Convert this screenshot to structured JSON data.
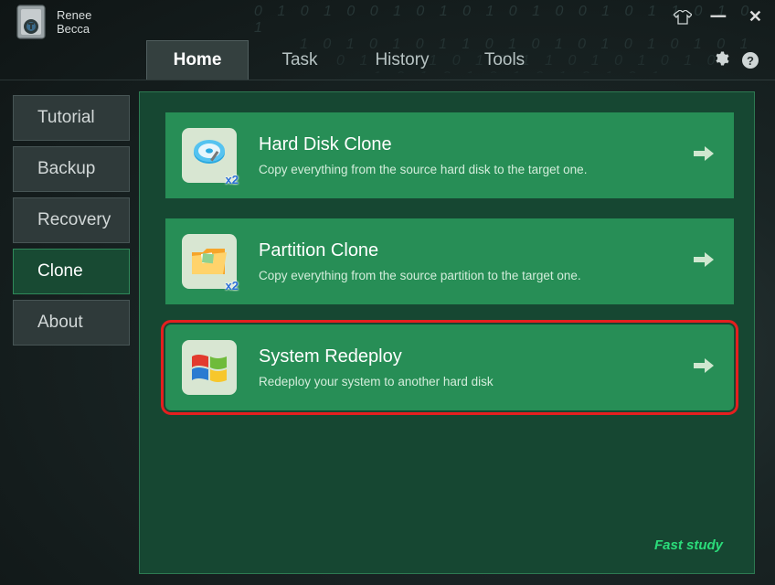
{
  "app": {
    "title_line1": "Renee",
    "title_line2": "Becca"
  },
  "top_tabs": [
    {
      "label": "Home",
      "active": true
    },
    {
      "label": "Task",
      "active": false
    },
    {
      "label": "History",
      "active": false
    },
    {
      "label": "Tools",
      "active": false
    }
  ],
  "sidebar": {
    "items": [
      {
        "label": "Tutorial",
        "active": false
      },
      {
        "label": "Backup",
        "active": false
      },
      {
        "label": "Recovery",
        "active": false
      },
      {
        "label": "Clone",
        "active": true
      },
      {
        "label": "About",
        "active": false
      }
    ]
  },
  "cards": [
    {
      "title": "Hard Disk Clone",
      "desc": "Copy everything from the source hard disk to the target one.",
      "badge": "x2",
      "icon": "hard-disk-icon",
      "highlight": false
    },
    {
      "title": "Partition Clone",
      "desc": "Copy everything from the source partition to the target one.",
      "badge": "x2",
      "icon": "folder-icon",
      "highlight": false
    },
    {
      "title": "System Redeploy",
      "desc": "Redeploy your system to another hard disk",
      "badge": "",
      "icon": "windows-flag-icon",
      "highlight": true
    }
  ],
  "footer": {
    "fast_study": "Fast study"
  },
  "help_char": "?"
}
